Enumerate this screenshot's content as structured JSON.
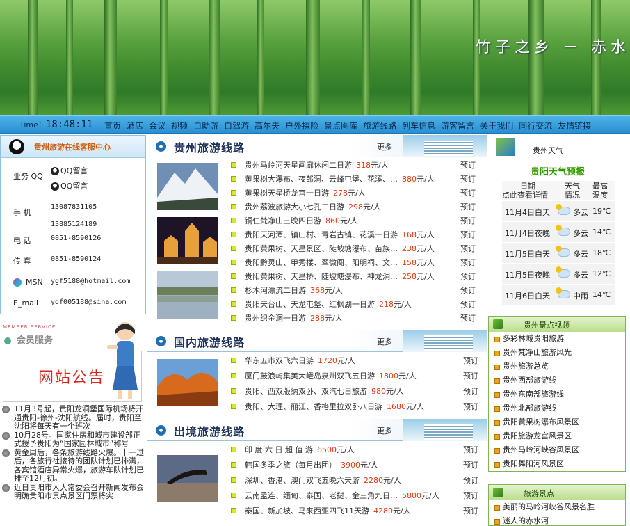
{
  "banner": {
    "slogan": "竹子之乡 － 赤水"
  },
  "nav": {
    "time_label": "Time：",
    "time": "18:48:11",
    "items": [
      "首页",
      "酒店",
      "会议",
      "视频",
      "自助游",
      "自驾游",
      "高尔夫",
      "户外探险",
      "景点图库",
      "旅游线路",
      "列车信息",
      "游客留言",
      "关于我们",
      "同行交流",
      "友情链接"
    ]
  },
  "service": {
    "title": "贵州旅游在线客服中心",
    "qq_label": "业务 QQ",
    "qq_items": [
      "QQ留言",
      "QQ留言"
    ],
    "mobile_label": "手  机",
    "mobiles": [
      "13087831105",
      "13885124189"
    ],
    "phone_label": "电  话",
    "phone": "0851-8590126",
    "fax_label": "传  真",
    "fax": "0851-8590124",
    "msn_label": "MSN",
    "msn": "ygf5188@hotmail.com",
    "email_label": "E_mail",
    "email": "ygf005188@sina.com"
  },
  "member": {
    "small": "MEMBER SERVICE",
    "title": "会员服务"
  },
  "notice": {
    "title": "网站公告"
  },
  "news": [
    "11月3号起，贵阳龙洞堡国际机场将开通贵阳-徐州-沈阳航线。届时，贵阳至沈阳将每天有一个班次",
    "10月28号。国家住房和城市建设部正式授予贵阳为“国家园林城市”称号",
    "黄金周后，各条旅游线路火爆。十一过后，各旅行社接待的团队计划已排满，各宾馆酒店异常火爆，旅游车队计划已排至12月初。",
    "近日贵阳市人大常委会召开新闻发布会明确贵阳市景点景区门票将实"
  ],
  "sections": [
    {
      "title": "贵州旅游线路",
      "more": "更多",
      "trips": [
        {
          "name": "贵州马岭河天星画廊休闲二日游",
          "price": "318",
          "unit": "元/人",
          "book": "预订"
        },
        {
          "name": "黄果树大瀑布、夜郎洞、云峰屯堡、花溪、…",
          "price": "880",
          "unit": "元/人",
          "book": "预订"
        },
        {
          "name": "黄果树天星桥龙宫一日游",
          "price": "278",
          "unit": "元/人",
          "book": "预订"
        },
        {
          "name": "贵州荔波旅游大小七孔二日游",
          "price": "298",
          "unit": "元/人",
          "book": "预订"
        },
        {
          "name": "铜仁梵净山三晚四日游",
          "price": "860",
          "unit": "元/人",
          "book": "预订"
        },
        {
          "name": "贵阳天河潭、镇山村、青岩古镇、花溪一日游",
          "price": "168",
          "unit": "元/人",
          "book": "预订"
        },
        {
          "name": "贵阳黄果树、天星景区、陡坡塘瀑布、苗族…",
          "price": "238",
          "unit": "元/人",
          "book": "预订"
        },
        {
          "name": "贵阳黔灵山、甲秀楼、翠微阁、阳明祠、文…",
          "price": "158",
          "unit": "元/人",
          "book": "预订"
        },
        {
          "name": "贵阳黄果树、天星桥、陡坡塘瀑布、神龙洞…",
          "price": "258",
          "unit": "元/人",
          "book": "预订"
        },
        {
          "name": "杉木河漂流二日游",
          "price": "368",
          "unit": "元/人",
          "book": "预订"
        },
        {
          "name": "贵阳天台山、天龙屯堡、红枫湖一日游",
          "price": "218",
          "unit": "元/人",
          "book": "预订"
        },
        {
          "name": "贵州织金洞一日游",
          "price": "288",
          "unit": "元/人",
          "book": "预订"
        }
      ]
    },
    {
      "title": "国内旅游线路",
      "more": "更多",
      "trips": [
        {
          "name": "华东五市双飞六日游",
          "price": "1720",
          "unit": "元/人",
          "book": "预订"
        },
        {
          "name": "厦门鼓浪屿集美大嶝岛泉州双飞五日游",
          "price": "1800",
          "unit": "元/人",
          "book": "预订"
        },
        {
          "name": "贵阳、西双版纳双卧、双汽七日旅游",
          "price": "980",
          "unit": "元/人",
          "book": "预订"
        },
        {
          "name": "贵阳、大理、丽江、香格里拉双卧八日游",
          "price": "1680",
          "unit": "元/人",
          "book": "预订"
        }
      ]
    },
    {
      "title": "出境旅游线路",
      "more": "更多",
      "trips": [
        {
          "name": "印 度 六 日 超 值 游",
          "price": "6500",
          "unit": "元/人",
          "book": "预订"
        },
        {
          "name": "韩国冬季之旅（每月出团）",
          "price": "3900",
          "unit": "元/人",
          "book": "预订"
        },
        {
          "name": "深圳、香港、澳门双飞五晚六天游",
          "price": "2280",
          "unit": "元/人",
          "book": "预订"
        },
        {
          "name": "云南孟连、缅甸、泰国、老挝、金三角九日…",
          "price": "5800",
          "unit": "元/人",
          "book": "预订"
        },
        {
          "name": "泰国、新加坡、马来西亚四飞11天游",
          "price": "4280",
          "unit": "元/人",
          "book": "预订"
        }
      ]
    }
  ],
  "weather": {
    "label": "贵州天气",
    "title": "贵阳天气预报",
    "header": {
      "date": "日期",
      "date_sub": "点此查看详情",
      "cond": "天气",
      "cond_sub": "情况",
      "temp": "最高",
      "temp_sub": "温度"
    },
    "rows": [
      {
        "date": "11月4日白天",
        "cond": "多云",
        "temp": "19℃"
      },
      {
        "date": "11月4日夜晚",
        "cond": "多云",
        "temp": "14℃"
      },
      {
        "date": "11月5日白天",
        "cond": "多云",
        "temp": "18℃"
      },
      {
        "date": "11月5日夜晚",
        "cond": "多云",
        "temp": "12℃"
      },
      {
        "date": "11月6日白天",
        "cond": "中雨",
        "temp": "14℃"
      }
    ]
  },
  "videos": {
    "title": "贵州景点视频",
    "items": [
      "多彩林城贵阳旅游",
      "贵州梵净山旅游风光",
      "贵州旅游总览",
      "贵州西部旅游线",
      "贵州东南部旅游线",
      "贵州北部旅游线",
      "贵阳黄果树瀑布风景区",
      "贵阳旅游龙宫风景区",
      "贵州马岭河峡谷风景区",
      "贵阳舞阳河风景区"
    ]
  },
  "spots": {
    "title": "旅游景点",
    "items": [
      "美丽的马岭河峡谷风景名胜",
      "迷人的赤水河"
    ]
  }
}
